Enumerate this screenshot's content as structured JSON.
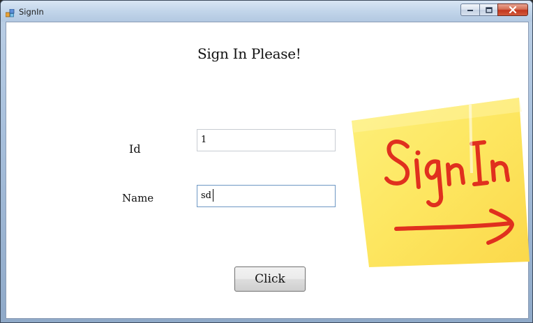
{
  "window": {
    "title": "SignIn",
    "controls": {
      "minimize": "minimize-icon",
      "maximize": "maximize-icon",
      "close": "close-icon"
    }
  },
  "form": {
    "heading": "Sign In Please!",
    "id_label": "Id",
    "id_value": "1",
    "name_label": "Name",
    "name_value": "sd",
    "button_label": "Click"
  },
  "sticky_note": {
    "text": "Sign In",
    "note_color": "#fde25a",
    "ink_color": "#e0301e"
  }
}
